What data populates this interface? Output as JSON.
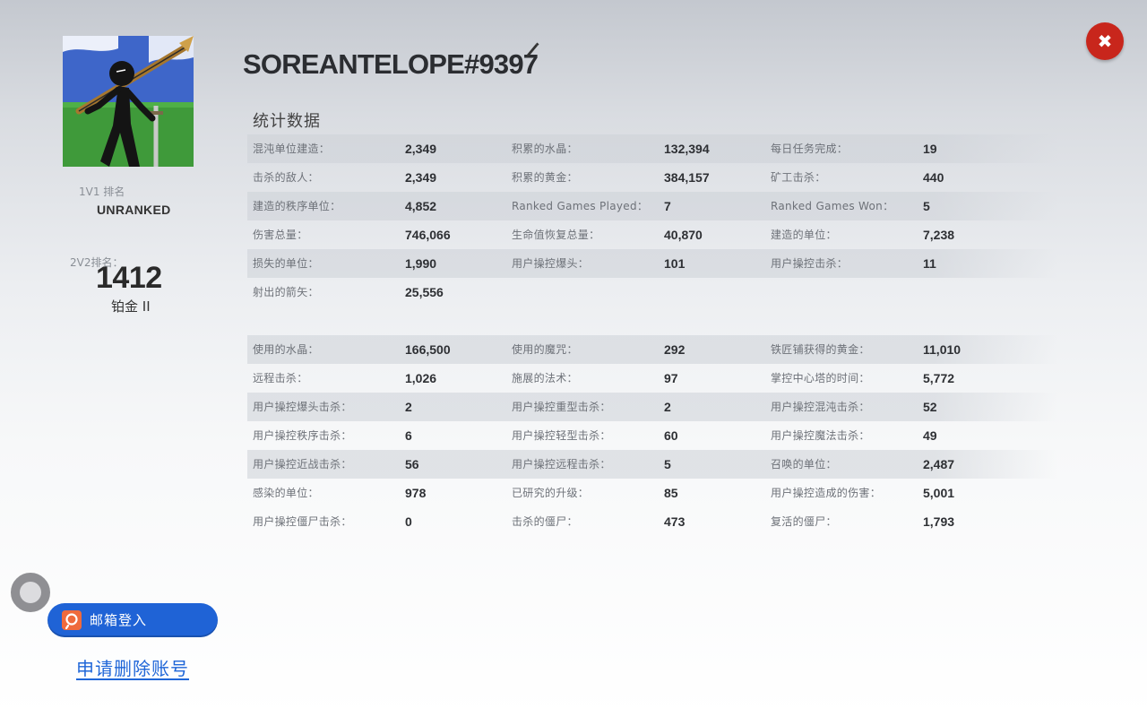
{
  "profile": {
    "username": "SOREANTELOPE#9397",
    "rank_1v1_label": "1V1 排名",
    "rank_1v1_value": "UNRANKED",
    "rank_2v2_label": "2V2排名：",
    "rank_2v2_value": "1412",
    "rank_2v2_tier": "铂金 II"
  },
  "header": {
    "close_symbol": "✖",
    "edit_icon": "pencil-icon"
  },
  "stats": {
    "title": "统计数据",
    "table1": [
      [
        {
          "label": "混沌单位建造：",
          "value": "2,349"
        },
        {
          "label": "积累的水晶：",
          "value": "132,394"
        },
        {
          "label": "每日任务完成：",
          "value": "19"
        }
      ],
      [
        {
          "label": "击杀的敌人：",
          "value": "2,349"
        },
        {
          "label": "积累的黄金：",
          "value": "384,157"
        },
        {
          "label": "矿工击杀：",
          "value": "440"
        }
      ],
      [
        {
          "label": "建造的秩序单位：",
          "value": "4,852"
        },
        {
          "label": "Ranked Games Played：",
          "value": "7"
        },
        {
          "label": "Ranked Games Won：",
          "value": "5"
        }
      ],
      [
        {
          "label": "伤害总量：",
          "value": "746,066"
        },
        {
          "label": "生命值恢复总量：",
          "value": "40,870"
        },
        {
          "label": "建造的单位：",
          "value": "7,238"
        }
      ],
      [
        {
          "label": "损失的单位：",
          "value": "1,990"
        },
        {
          "label": "用户操控爆头：",
          "value": "101"
        },
        {
          "label": "用户操控击杀：",
          "value": "11"
        }
      ],
      [
        {
          "label": "射出的箭矢：",
          "value": "25,556"
        },
        {
          "label": "",
          "value": ""
        },
        {
          "label": "",
          "value": ""
        }
      ]
    ],
    "table2": [
      [
        {
          "label": "使用的水晶：",
          "value": "166,500"
        },
        {
          "label": "使用的魔咒：",
          "value": "292"
        },
        {
          "label": "铁匠铺获得的黄金：",
          "value": "11,010"
        }
      ],
      [
        {
          "label": "远程击杀：",
          "value": "1,026"
        },
        {
          "label": "施展的法术：",
          "value": "97"
        },
        {
          "label": "掌控中心塔的时间：",
          "value": "5,772"
        }
      ],
      [
        {
          "label": "用户操控爆头击杀：",
          "value": "2"
        },
        {
          "label": "用户操控重型击杀：",
          "value": "2"
        },
        {
          "label": "用户操控混沌击杀：",
          "value": "52"
        }
      ],
      [
        {
          "label": "用户操控秩序击杀：",
          "value": "6"
        },
        {
          "label": "用户操控轻型击杀：",
          "value": "60"
        },
        {
          "label": "用户操控魔法击杀：",
          "value": "49"
        }
      ],
      [
        {
          "label": "用户操控近战击杀：",
          "value": "56"
        },
        {
          "label": "用户操控远程击杀：",
          "value": "5"
        },
        {
          "label": "召唤的单位：",
          "value": "2,487"
        }
      ],
      [
        {
          "label": "感染的单位：",
          "value": "978"
        },
        {
          "label": "已研究的升级：",
          "value": "85"
        },
        {
          "label": "用户操控造成的伤害：",
          "value": "5,001"
        }
      ],
      [
        {
          "label": "用户操控僵尸击杀：",
          "value": "0"
        },
        {
          "label": "击杀的僵尸：",
          "value": "473"
        },
        {
          "label": "复活的僵尸：",
          "value": "1,793"
        }
      ]
    ]
  },
  "actions": {
    "email_login_label": "邮箱登入",
    "delete_account_label": "申请删除账号"
  },
  "colors": {
    "close_button": "#c8261c",
    "login_button": "#1f63d6",
    "login_icon": "#ef6a3c",
    "link": "#1f66d8"
  }
}
